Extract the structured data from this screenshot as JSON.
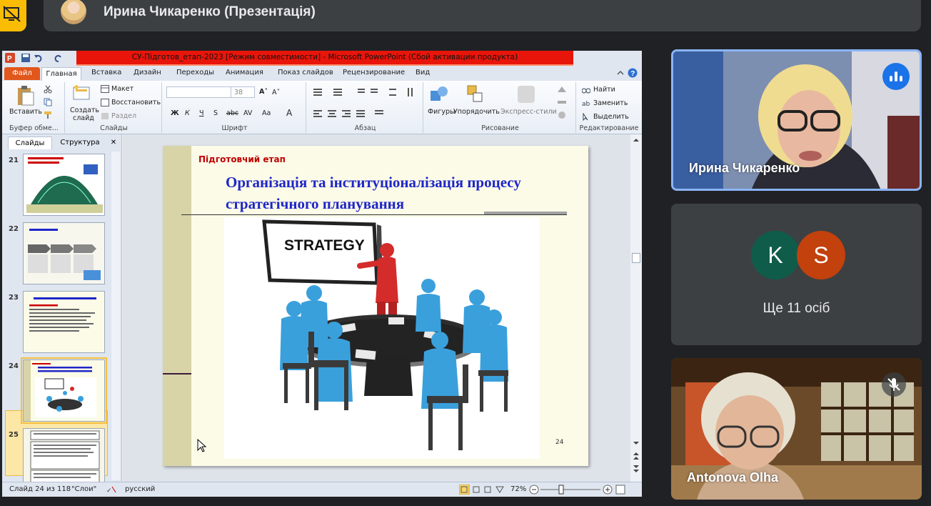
{
  "presenter": {
    "name": "Ирина Чикаренко (Презентація)"
  },
  "powerpoint": {
    "window_title": "СУ-Підготов_етап-2023 [Режим совместимости]  -  Microsoft PowerPoint (Сбой активации продукта)",
    "menu": {
      "file": "Файл",
      "tabs": [
        "Главная",
        "Вставка",
        "Дизайн",
        "Переходы",
        "Анимация",
        "Показ слайдов",
        "Рецензирование",
        "Вид"
      ]
    },
    "ribbon": {
      "paste": "Вставить",
      "clipboard_group": "Буфер обме...",
      "create_slide": "Создать",
      "create_slide2": "слайд",
      "layout": "Макет",
      "reset": "Восстановить",
      "section": "Раздел",
      "slides_group": "Слайды",
      "font_size": "38",
      "font_group": "Шрифт",
      "paragraph_group": "Абзац",
      "shapes": "Фигуры",
      "arrange": "Упорядочить",
      "quick_styles": "Экспресс-стили",
      "drawing_group": "Рисование",
      "find": "Найти",
      "replace": "Заменить",
      "select": "Выделить",
      "editing_group": "Редактирование"
    },
    "panel": {
      "tab_slides": "Слайды",
      "tab_outline": "Структура",
      "close": "✕",
      "thumbnails": [
        {
          "number": "21"
        },
        {
          "number": "22"
        },
        {
          "number": "23"
        },
        {
          "number": "24"
        },
        {
          "number": "25"
        }
      ]
    },
    "slide": {
      "subtitle": "Підготовчий етап",
      "title": "Організація та інституціоналізація процесу стратегічного планування",
      "board_text": "STRATEGY",
      "page_number": "24"
    },
    "status": {
      "slide_info": "Слайд 24 из 118",
      "theme": "\"Слои\"",
      "language": "русский",
      "zoom": "72%"
    }
  },
  "participants": {
    "irina": {
      "name": "Ирина Чикаренко"
    },
    "more": {
      "avatar1": "K",
      "avatar1_color": "#0f5c4b",
      "avatar2": "S",
      "avatar2_color": "#c2410c",
      "label": "Ще 11 осіб"
    },
    "olha": {
      "name": "Antonova Olha"
    }
  }
}
